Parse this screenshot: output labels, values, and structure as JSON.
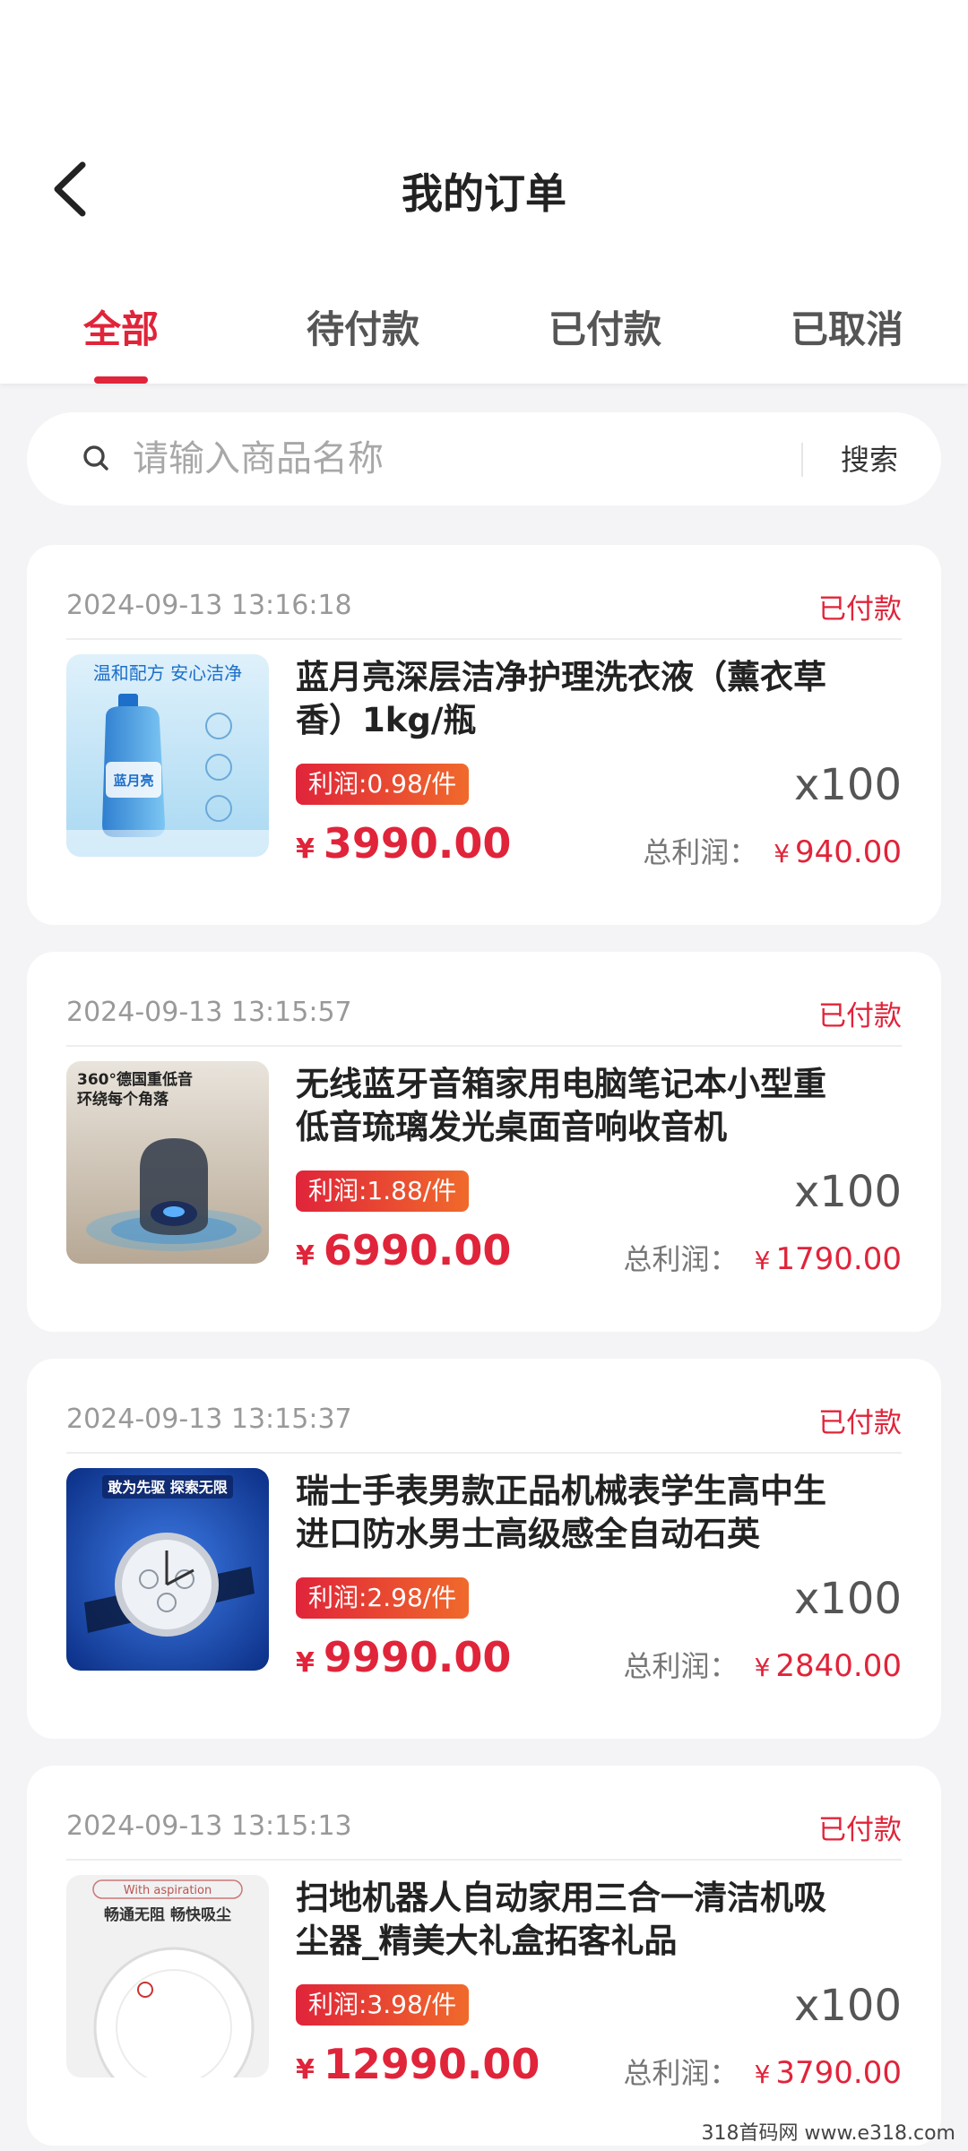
{
  "header": {
    "title": "我的订单",
    "back_icon": "chevron-left-icon"
  },
  "tabs": [
    {
      "label": "全部",
      "active": true
    },
    {
      "label": "待付款",
      "active": false
    },
    {
      "label": "已付款",
      "active": false
    },
    {
      "label": "已取消",
      "active": false
    }
  ],
  "search": {
    "placeholder": "请输入商品名称",
    "value": "",
    "button_label": "搜索",
    "icon": "search-icon"
  },
  "orders": [
    {
      "time": "2024-09-13 13:16:18",
      "status": "已付款",
      "name": "蓝月亮深层洁净护理洗衣液（薰衣草香）1kg/瓶",
      "profit": "利润:0.98/件",
      "qty": "x100",
      "currency": "¥",
      "price": "3990.00",
      "total_label": "总利润：",
      "total": "940.00",
      "image": {
        "kind": "detergent",
        "text_1": "温和配方 安心洁净",
        "text_2": "蓝月亮"
      }
    },
    {
      "time": "2024-09-13 13:15:57",
      "status": "已付款",
      "name": "无线蓝牙音箱家用电脑笔记本小型重低音琉璃发光桌面音响收音机",
      "profit": "利润:1.88/件",
      "qty": "x100",
      "currency": "¥",
      "price": "6990.00",
      "total_label": "总利润：",
      "total": "1790.00",
      "image": {
        "kind": "speaker",
        "text_1": "360°德国重低音",
        "text_2": "环绕每个角落"
      }
    },
    {
      "time": "2024-09-13 13:15:37",
      "status": "已付款",
      "name": "瑞士手表男款正品机械表学生高中生进口防水男士高级感全自动石英",
      "profit": "利润:2.98/件",
      "qty": "x100",
      "currency": "¥",
      "price": "9990.00",
      "total_label": "总利润：",
      "total": "2840.00",
      "image": {
        "kind": "watch",
        "text_1": "敢为先驱 探索无限",
        "text_2": ""
      }
    },
    {
      "time": "2024-09-13 13:15:13",
      "status": "已付款",
      "name": "扫地机器人自动家用三合一清洁机吸尘器_精美大礼盒拓客礼品",
      "profit": "利润:3.98/件",
      "qty": "x100",
      "currency": "¥",
      "price": "12990.00",
      "total_label": "总利润：",
      "total": "3790.00",
      "image": {
        "kind": "robot",
        "text_1": "畅通无阻 畅快吸尘",
        "text_2": "With aspiration"
      }
    }
  ],
  "watermark": "318首码网 www.e318.com",
  "colors": {
    "accent": "#e0243a",
    "profit_gradient_end": "#f06a2b",
    "background": "#f4f4f6"
  }
}
